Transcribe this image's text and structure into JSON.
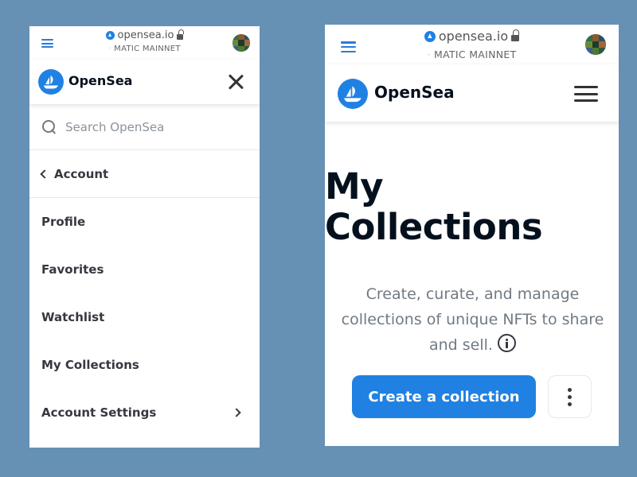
{
  "browser": {
    "url": "opensea.io",
    "network": "MATIC MAINNET"
  },
  "brand": {
    "name": "OpenSea",
    "color": "#2081e2"
  },
  "menu": {
    "search_placeholder": "Search OpenSea",
    "back_label": "Account",
    "items": [
      {
        "label": "Profile"
      },
      {
        "label": "Favorites"
      },
      {
        "label": "Watchlist"
      },
      {
        "label": "My Collections"
      },
      {
        "label": "Account Settings"
      }
    ]
  },
  "collections_page": {
    "title": "My\nCollections",
    "description": "Create, curate, and manage collections of unique NFTs to share and sell.",
    "create_button": "Create a collection"
  },
  "icons": {
    "tabs": "tabs-icon",
    "lock": "lock-icon",
    "close": "close-icon",
    "hamburger": "hamburger-icon",
    "search": "search-icon",
    "back": "chevron-left-icon",
    "forward": "chevron-right-icon",
    "info": "info-icon",
    "more": "more-vertical-icon"
  }
}
